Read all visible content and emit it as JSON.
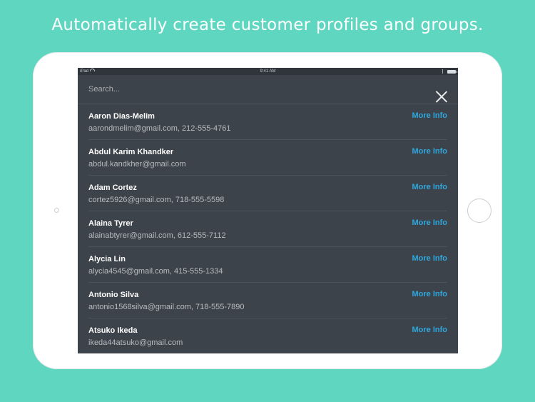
{
  "headline": "Automatically create customer profiles and groups.",
  "status_bar": {
    "device": "iPad",
    "time": "9:41 AM"
  },
  "search": {
    "placeholder": "Search..."
  },
  "more_info_label": "More Info",
  "customers": [
    {
      "name": "Aaron Dias-Melim",
      "detail": "aarondmelim@gmail.com, 212-555-4761"
    },
    {
      "name": "Abdul Karim Khandker",
      "detail": "abdul.kandkher@gmail.com"
    },
    {
      "name": "Adam Cortez",
      "detail": "cortez5926@gmail.com, 718-555-5598"
    },
    {
      "name": "Alaina Tyrer",
      "detail": "alainabtyrer@gmail.com, 612-555-7112"
    },
    {
      "name": "Alycia Lin",
      "detail": "alycia4545@gmail.com, 415-555-1334"
    },
    {
      "name": "Antonio Silva",
      "detail": "antonio1568silva@gmail.com, 718-555-7890"
    },
    {
      "name": "Atsuko Ikeda",
      "detail": "ikeda44atsuko@gmail.com"
    }
  ],
  "colors": {
    "background": "#5ed6c0",
    "screen": "#3d434a",
    "accent": "#2fa7dd"
  }
}
